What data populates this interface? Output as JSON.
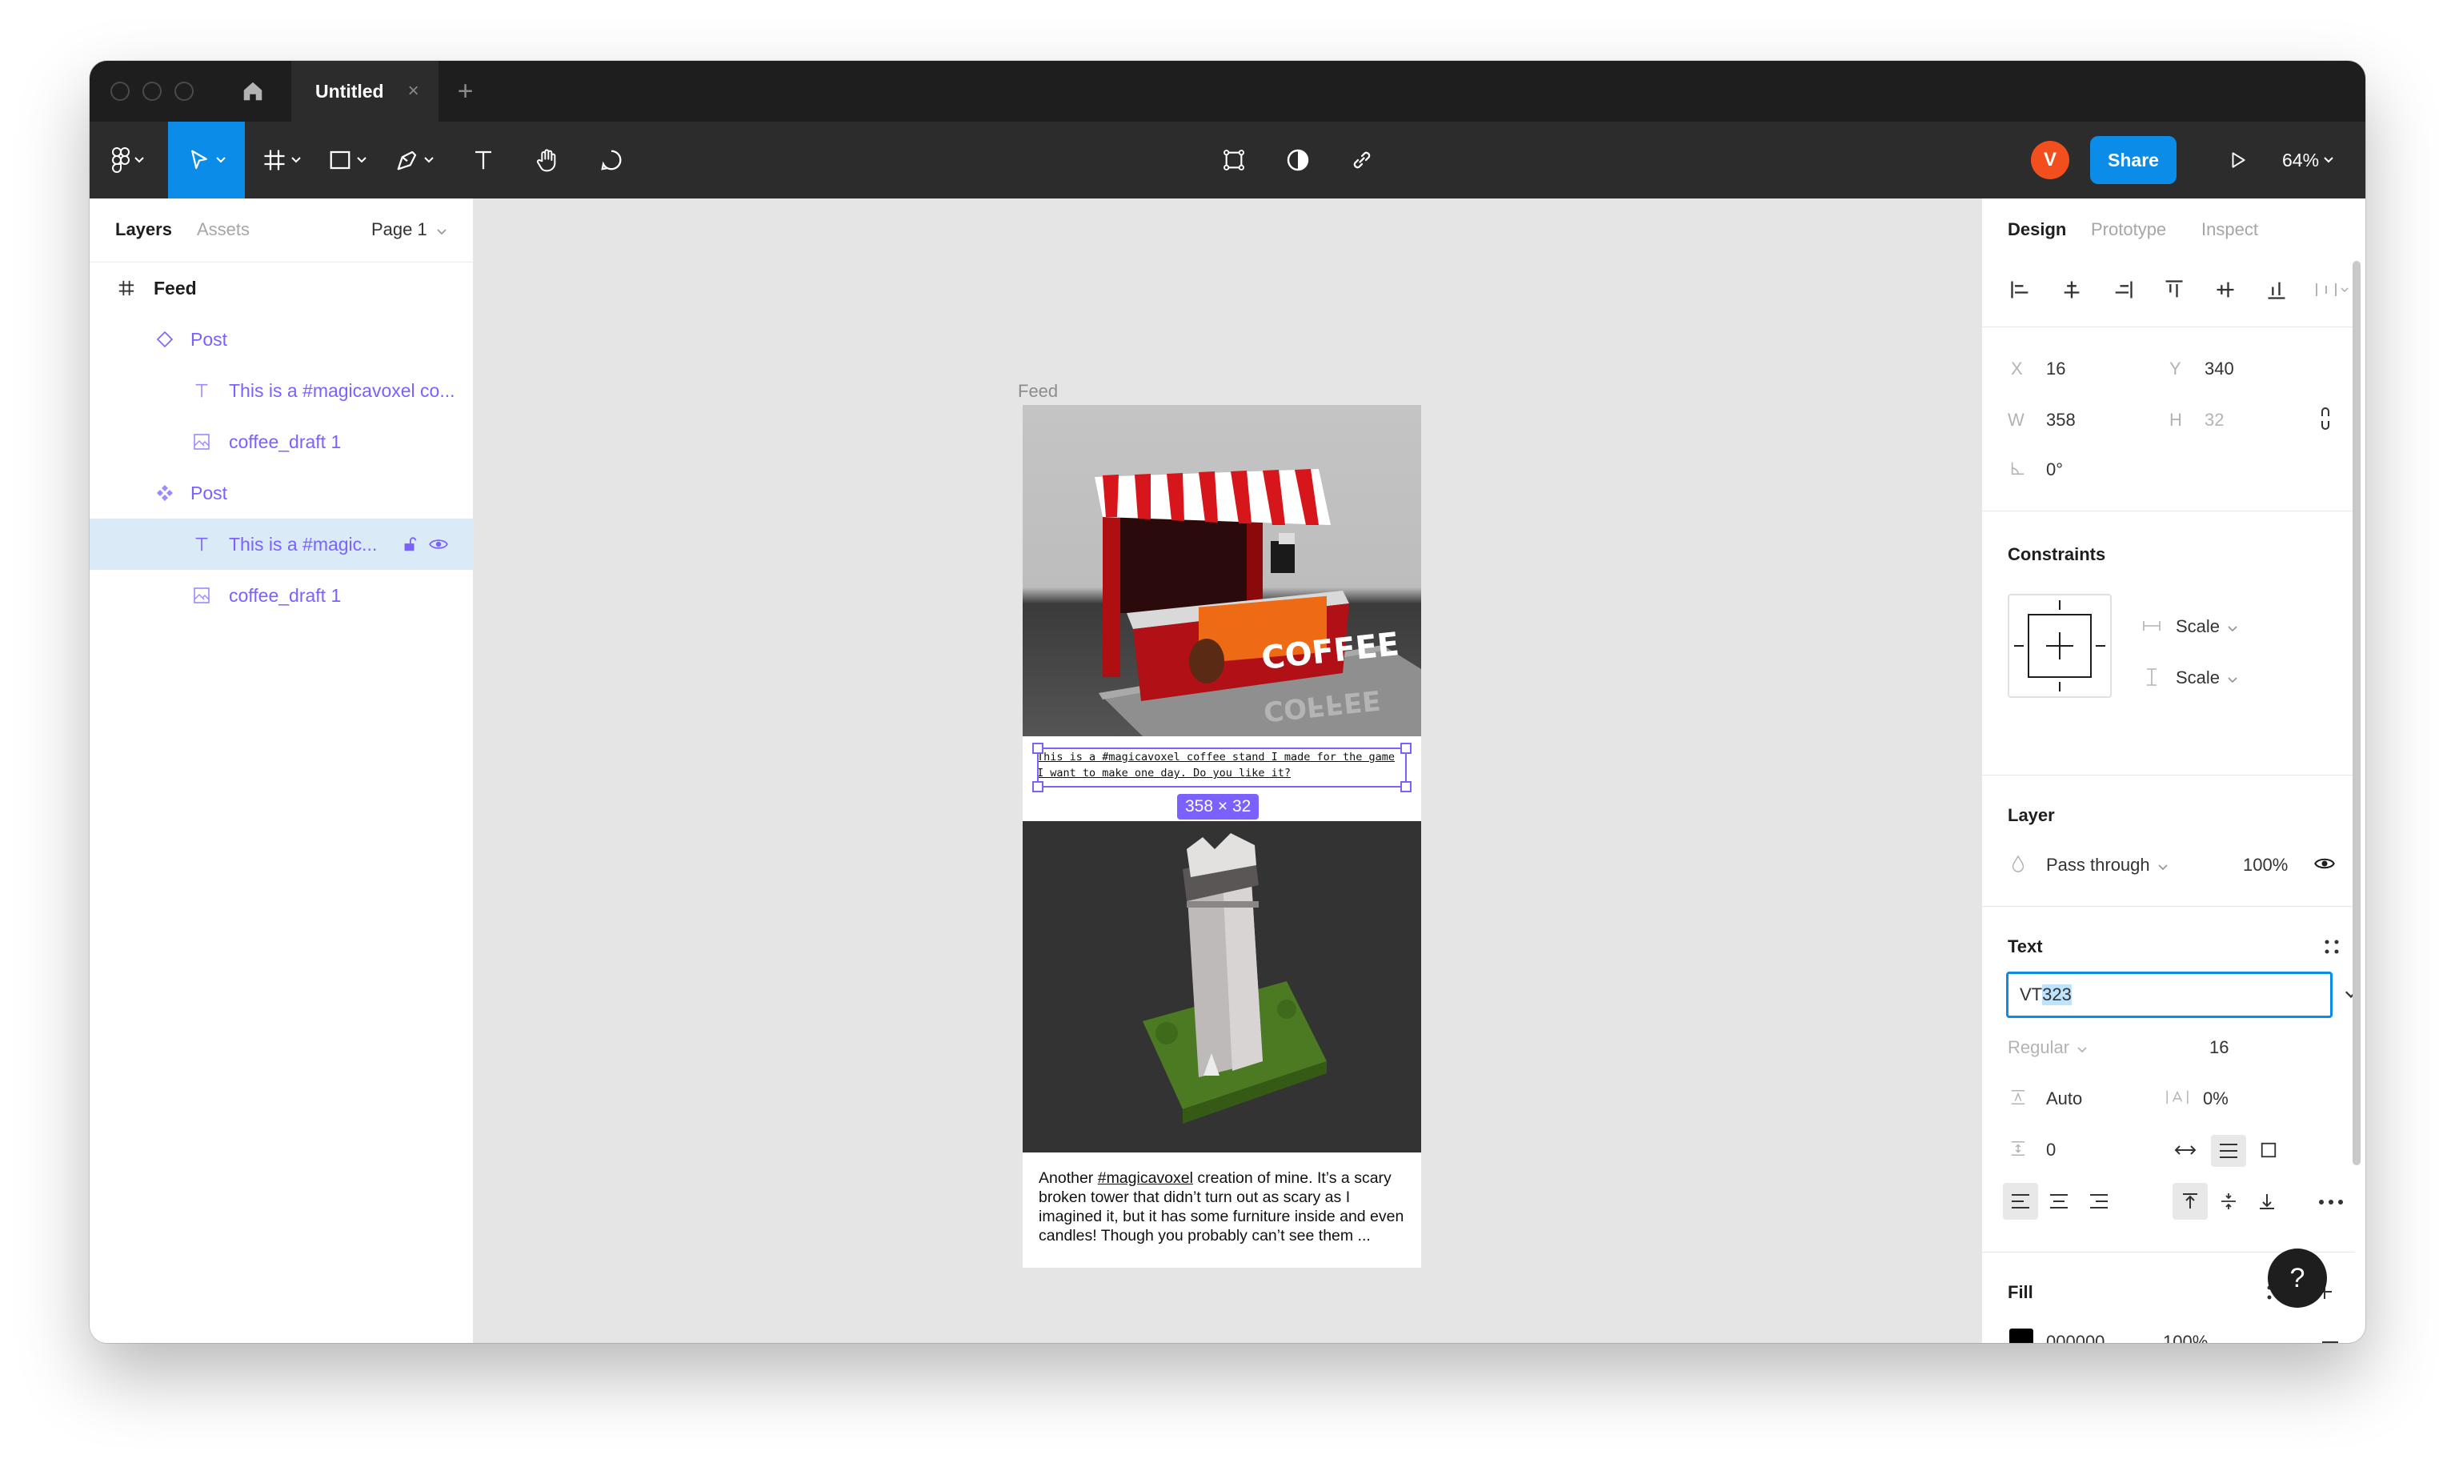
{
  "titlebar": {
    "tab_title": "Untitled",
    "close_glyph": "×",
    "new_tab_glyph": "+"
  },
  "toolbar": {
    "tools": [
      "figma-menu-icon",
      "move-tool-icon",
      "frame-tool-icon",
      "shape-tool-icon",
      "pen-tool-icon",
      "text-tool-icon",
      "hand-tool-icon",
      "comment-tool-icon"
    ],
    "center": [
      "component-icon",
      "mask-icon",
      "link-icon"
    ],
    "avatar_initial": "V",
    "share_label": "Share",
    "zoom": "64%",
    "accent": "#0c8ce9"
  },
  "left_panel": {
    "tabs": {
      "layers": "Layers",
      "assets": "Assets"
    },
    "page_selector": "Page 1",
    "layers": [
      {
        "label": "Feed",
        "icon": "frame-icon"
      },
      {
        "label": "Post",
        "icon": "component-instance-icon"
      },
      {
        "label": "This is a #magicavoxel co...",
        "icon": "text-layer-icon"
      },
      {
        "label": "coffee_draft 1",
        "icon": "image-layer-icon"
      },
      {
        "label": "Post",
        "icon": "component-main-icon"
      },
      {
        "label": "This is a #magic...",
        "icon": "text-layer-icon",
        "selected": true
      },
      {
        "label": "coffee_draft 1",
        "icon": "image-layer-icon"
      }
    ]
  },
  "canvas": {
    "frame_label": "Feed",
    "post1_text": "This is a #magicavoxel coffee stand I made for the game I want to make one day. Do you like it?",
    "selection_size": "358 × 32",
    "post2_text_before": "Another ",
    "post2_tag": "#magicavoxel",
    "post2_text_after": " creation of mine. It’s a scary broken tower that didn’t turn out as scary as I imagined it, but it has some furniture inside and even candles! Though you probably can’t see them ..."
  },
  "right_panel": {
    "tabs": {
      "design": "Design",
      "prototype": "Prototype",
      "inspect": "Inspect"
    },
    "position": {
      "x_label": "X",
      "x": "16",
      "y_label": "Y",
      "y": "340",
      "w_label": "W",
      "w": "358",
      "h_label": "H",
      "h": "32",
      "rotation": "0°"
    },
    "constraints": {
      "title": "Constraints",
      "horizontal": "Scale",
      "vertical": "Scale"
    },
    "layer": {
      "title": "Layer",
      "blend": "Pass through",
      "opacity": "100%"
    },
    "text": {
      "title": "Text",
      "font_family_prefix": "VT",
      "font_family_selected": "323",
      "font_style": "Regular",
      "font_size": "16",
      "line_height": "Auto",
      "letter_spacing": "0%",
      "paragraph_spacing": "0"
    },
    "fill": {
      "title": "Fill",
      "hex": "000000",
      "opacity": "100%",
      "color": "#000000"
    },
    "help_glyph": "?"
  }
}
